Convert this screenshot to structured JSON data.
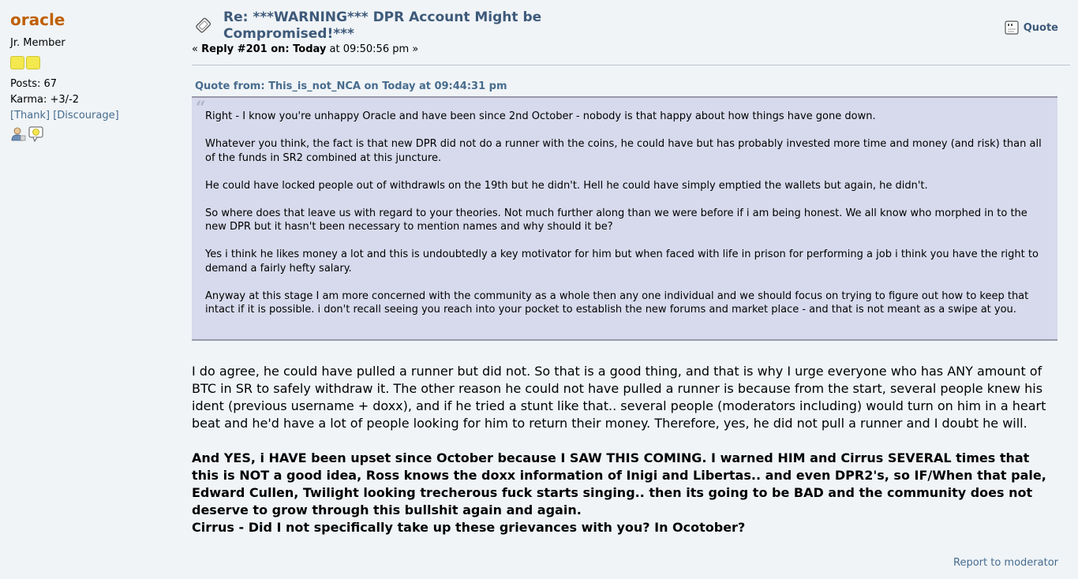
{
  "poster": {
    "name": "oracle",
    "rank": "Jr. Member",
    "posts": "Posts: 67",
    "karma": "Karma: +3/-2",
    "thank_link": "[Thank]",
    "discourage_link": "[Discourage]",
    "star_color": "#f3e84d",
    "icons": [
      "user-profile-icon",
      "personal-message-icon"
    ]
  },
  "post": {
    "subject": "Re: ***WARNING*** DPR Account Might be Compromised!***",
    "reply_prefix": "« ",
    "reply_label": "Reply #201 on: Today",
    "reply_time": " at 09:50:56 pm »",
    "quote_button": "Quote",
    "quote_header": "Quote from: This_is_not_NCA on Today at 09:44:31 pm",
    "quote_paragraphs": [
      "Right - I know you're unhappy Oracle and have been since 2nd October - nobody is that happy about how things have gone down.",
      "Whatever you think, the fact is that new DPR did not do a runner with the coins, he could have but has probably invested more time and money (and risk) than all of the funds in SR2 combined at this juncture.",
      "He could have locked people out of withdrawls on the 19th but he didn't. Hell he could have simply emptied the wallets but again, he didn't.",
      "So where does that leave us with regard to your theories. Not much further along than we were before if i am being honest. We all know who morphed in to the new DPR but it hasn't been necessary to mention names and why should it be?",
      "Yes i think he likes money a lot and this is undoubtedly a key motivator for him but when faced with life in prison for performing a job i think you have the right to demand a fairly hefty salary.",
      "Anyway at this stage I am more concerned with the community as a whole then any one individual and we should focus on trying to figure out how to keep that intact if it is possible. i don't recall seeing you reach into your pocket to establish the new forums and market place - and that is not meant as a swipe at you."
    ],
    "body_paragraph": "I do agree, he could have pulled a runner but did not. So that is a good thing, and that is why I urge everyone who has ANY amount of BTC in SR to safely withdraw it. The other reason he could not have pulled a runner is because from the start, several people knew his ident (previous username + doxx), and if he tried a stunt like that.. several people (moderators including) would turn on him in a heart beat and he'd have a lot of people looking for him to return their money. Therefore, yes, he did not pull a runner and I doubt he will.",
    "bold_paragraph": "And YES, i HAVE been upset since October because I SAW THIS COMING. I warned HIM and Cirrus SEVERAL times that this is NOT a good idea, Ross knows the doxx information of Inigi and Libertas.. and even DPR2's, so IF/When that pale, Edward Cullen, Twilight looking trecherous fuck starts singing.. then its going to be BAD and the community does not deserve to grow through this bullshit again and again.",
    "bold_line": "Cirrus - Did I not specifically take up these grievances with you? In Ocotober?",
    "report_link": "Report to moderator"
  },
  "colors": {
    "background": "#f0f4f7",
    "username": "#c06002",
    "link": "#476c8e",
    "subject": "#3e5a7a",
    "quote_bg": "#d7daec"
  }
}
